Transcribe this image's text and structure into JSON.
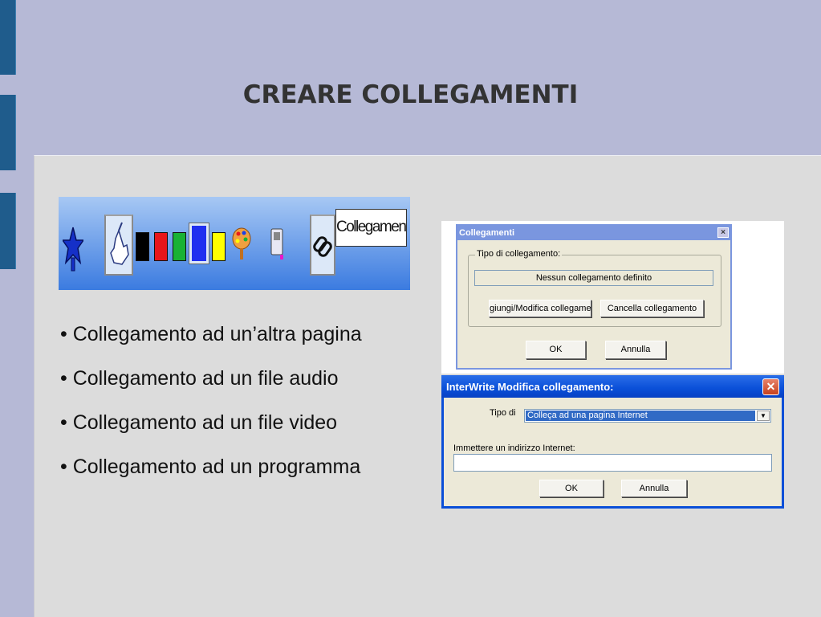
{
  "slide": {
    "title": "CREARE COLLEGAMENTI",
    "bullets": [
      "• Collegamento ad un’altra pagina",
      "• Collegamento ad un file audio",
      "• Collegamento ad un file video",
      "• Collegamento ad un programma"
    ]
  },
  "toolbar": {
    "label": "Collegamenti",
    "swatch_colors": [
      "#000000",
      "#e8161a",
      "#19b234",
      "#1f2ff0",
      "#ffff00"
    ]
  },
  "dialog_collegamenti": {
    "title": "Collegamenti",
    "close": "×",
    "group_label": "Tipo di collegamento:",
    "status_value": "Nessun collegamento definito",
    "add_button": "giungi/Modifica collegamen",
    "cancel_link_button": "Cancella collegamento",
    "ok_button": "OK",
    "cancel_button": "Annulla"
  },
  "dialog_interwrite": {
    "title": "InterWrite Modifica collegamento:",
    "close": "✕",
    "type_label": "Tipo di",
    "type_value": "Colleça ad una pagina Internet",
    "dropdown_arrow": "▼",
    "url_label": "Immettere un indirizzo Internet:",
    "url_value": "",
    "ok_button": "OK",
    "cancel_button": "Annulla"
  }
}
